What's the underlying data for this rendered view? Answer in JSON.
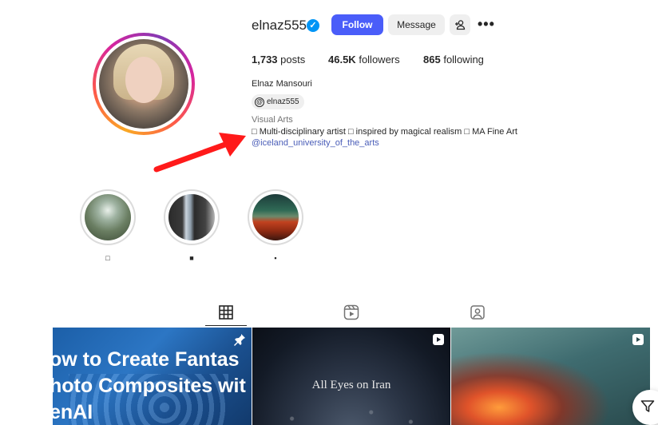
{
  "profile": {
    "username": "elnaz555",
    "verified_badge": "✓",
    "follow_label": "Follow",
    "message_label": "Message",
    "more_label": "•••",
    "posts_count": "1,733",
    "posts_label": "posts",
    "followers_count": "46.5K",
    "followers_label": "followers",
    "following_count": "865",
    "following_label": "following",
    "full_name": "Elnaz Mansouri",
    "threads_handle": "elnaz555",
    "category": "Visual Arts",
    "bio": "□ Multi-disciplinary artist □ inspired by magical realism □ MA Fine Art",
    "bio_link": "@iceland_university_of_the_arts"
  },
  "highlights": [
    {
      "label": "□"
    },
    {
      "label": "■"
    },
    {
      "label": "▪"
    }
  ],
  "tabs": [
    {
      "icon": "grid-icon",
      "active": true
    },
    {
      "icon": "reels-icon",
      "active": false
    },
    {
      "icon": "tagged-icon",
      "active": false
    }
  ],
  "posts": [
    {
      "overlay_text": "ow to Create Fantas\nhoto Composites wit\nenAI",
      "badge": "pin-icon"
    },
    {
      "overlay_text": "All Eyes on Iran",
      "badge": "reel-icon"
    },
    {
      "overlay_text": "",
      "badge": "reel-icon"
    }
  ],
  "colors": {
    "follow_button": "#4a5df9",
    "verified": "#0095f6",
    "link": "#4a5db8"
  }
}
